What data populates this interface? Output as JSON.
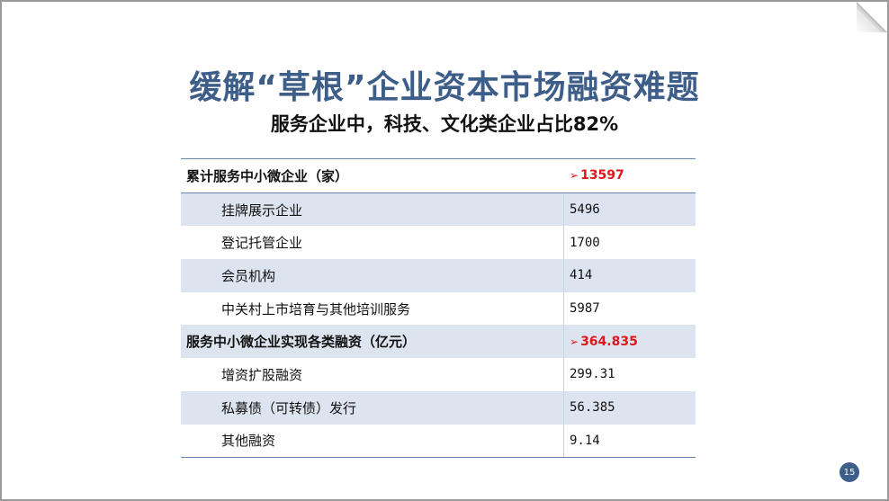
{
  "title": "缓解“草根”企业资本市场融资难题",
  "subtitle": "服务企业中，科技、文化类企业占比82%",
  "table": {
    "sections": [
      {
        "label": "累计服务中小微企业（家）",
        "value": "13597",
        "highlight_color": "#e0161b",
        "items": [
          {
            "label": "挂牌展示企业",
            "value": "5496"
          },
          {
            "label": "登记托管企业",
            "value": "1700"
          },
          {
            "label": "会员机构",
            "value": "414"
          },
          {
            "label": "中关村上市培育与其他培训服务",
            "value": "5987"
          }
        ]
      },
      {
        "label": "服务中小微企业实现各类融资（亿元）",
        "value": "364.835",
        "highlight_color": "#e0161b",
        "items": [
          {
            "label": "增资扩股融资",
            "value": "299.31"
          },
          {
            "label": "私募债（可转债）发行",
            "value": "56.385"
          },
          {
            "label": "其他融资",
            "value": "9.14"
          }
        ]
      }
    ]
  },
  "page_number": "15",
  "colors": {
    "title": "#3e5e8a",
    "row_shade": "#dce4ef",
    "highlight": "#e0161b"
  }
}
